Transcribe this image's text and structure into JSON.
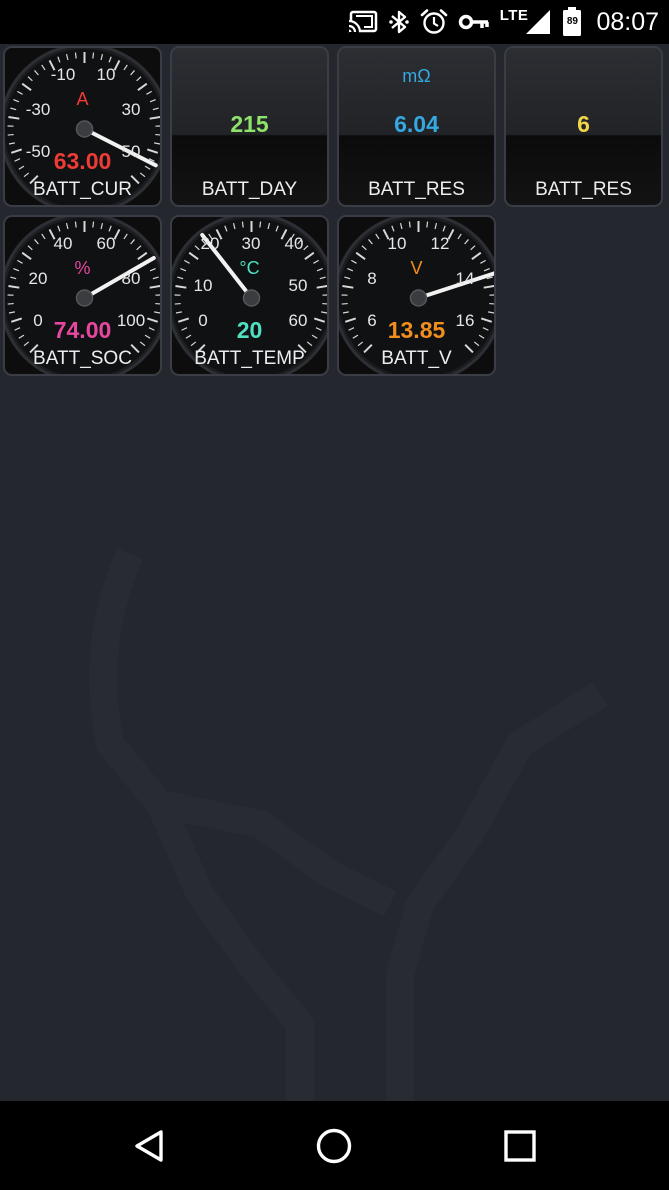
{
  "status_bar": {
    "time": "08:07",
    "network_label": "LTE",
    "battery_level": "89",
    "icons": [
      "cast-icon",
      "bluetooth-icon",
      "alarm-icon",
      "vpn-key-icon",
      "signal-icon",
      "battery-icon"
    ]
  },
  "gauges": [
    {
      "name": "BATT_CUR",
      "type": "dial",
      "unit": "A",
      "value": "63.00",
      "color": "#ee3b35",
      "ticks": [
        "-50",
        "-30",
        "-10",
        "10",
        "30",
        "50"
      ]
    },
    {
      "name": "BATT_DAY",
      "type": "digital",
      "unit": "",
      "value": "215",
      "color": "#8fe36a"
    },
    {
      "name": "BATT_RES",
      "type": "digital",
      "unit": "mΩ",
      "value": "6.04",
      "color": "#34a8e0"
    },
    {
      "name": "BATT_RES",
      "type": "digital",
      "unit": "",
      "value": "6",
      "color": "#f1d64a"
    },
    {
      "name": "BATT_SOC",
      "type": "dial",
      "unit": "%",
      "value": "74.00",
      "color": "#e8479f",
      "ticks": [
        "0",
        "20",
        "40",
        "60",
        "80",
        "100"
      ]
    },
    {
      "name": "BATT_TEMP",
      "type": "dial",
      "unit": "°C",
      "value": "20",
      "color": "#4fe0c4",
      "ticks": [
        "0",
        "10",
        "20",
        "30",
        "40",
        "50",
        "60"
      ]
    },
    {
      "name": "BATT_V",
      "type": "dial",
      "unit": "V",
      "value": "13.85",
      "color": "#f28e1c",
      "ticks": [
        "6",
        "8",
        "10",
        "12",
        "14",
        "16"
      ]
    }
  ],
  "nav_bar": {
    "icons": [
      "back-icon",
      "home-icon",
      "recents-icon"
    ]
  }
}
